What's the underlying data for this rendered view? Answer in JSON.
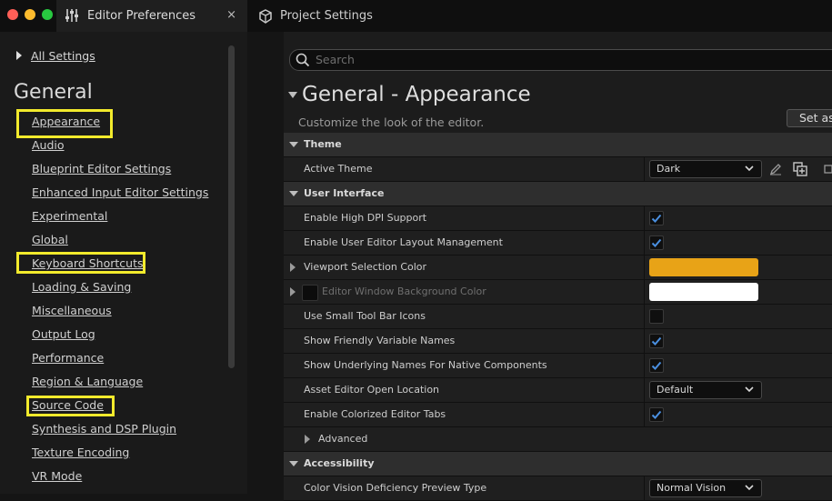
{
  "window": {
    "tabs": [
      {
        "label": "Editor Preferences",
        "icon": "sliders-icon",
        "active": true
      },
      {
        "label": "Project Settings",
        "icon": "cube-gear-icon",
        "active": false
      }
    ],
    "close_glyph": "×",
    "traffic_lights": [
      "#ff5f57",
      "#febc2e",
      "#28c840"
    ]
  },
  "sidebar": {
    "all_settings": "All Settings",
    "heading": "General",
    "categories": [
      {
        "label": "Appearance",
        "highlighted": true
      },
      {
        "label": "Audio",
        "highlighted": false
      },
      {
        "label": "Blueprint Editor Settings",
        "highlighted": false
      },
      {
        "label": "Enhanced Input Editor Settings",
        "highlighted": false
      },
      {
        "label": "Experimental",
        "highlighted": false
      },
      {
        "label": "Global",
        "highlighted": false
      },
      {
        "label": "Keyboard Shortcuts",
        "highlighted": true
      },
      {
        "label": "Loading & Saving",
        "highlighted": false
      },
      {
        "label": "Miscellaneous",
        "highlighted": false
      },
      {
        "label": "Output Log",
        "highlighted": false
      },
      {
        "label": "Performance",
        "highlighted": false
      },
      {
        "label": "Region & Language",
        "highlighted": false
      },
      {
        "label": "Source Code",
        "highlighted": true
      },
      {
        "label": "Synthesis and DSP Plugin",
        "highlighted": false
      },
      {
        "label": "Texture Encoding",
        "highlighted": false
      },
      {
        "label": "VR Mode",
        "highlighted": false
      }
    ],
    "highlight_color": "#f2ea2c"
  },
  "main": {
    "search_placeholder": "Search",
    "section_title": "General - Appearance",
    "section_description": "Customize the look of the editor.",
    "set_as_button": "Set as",
    "rows": [
      {
        "kind": "category",
        "label": "Theme"
      },
      {
        "kind": "prop",
        "label": "Active Theme",
        "control": "combo",
        "value": "Dark"
      },
      {
        "kind": "category",
        "label": "User Interface"
      },
      {
        "kind": "prop",
        "label": "Enable High DPI Support",
        "control": "check",
        "checked": true
      },
      {
        "kind": "prop",
        "label": "Enable User Editor Layout Management",
        "control": "check",
        "checked": true
      },
      {
        "kind": "prop",
        "label": "Viewport Selection Color",
        "control": "color",
        "color": "#e8a317",
        "expandable": true
      },
      {
        "kind": "prop",
        "label": "Editor Window Background Color",
        "control": "color",
        "color": "#ffffff",
        "expandable": true,
        "disabled": true
      },
      {
        "kind": "prop",
        "label": "Use Small Tool Bar Icons",
        "control": "check",
        "checked": false
      },
      {
        "kind": "prop",
        "label": "Show Friendly Variable Names",
        "control": "check",
        "checked": true
      },
      {
        "kind": "prop",
        "label": "Show Underlying Names For Native Components",
        "control": "check",
        "checked": true
      },
      {
        "kind": "prop",
        "label": "Asset Editor Open Location",
        "control": "combo",
        "value": "Default"
      },
      {
        "kind": "prop",
        "label": "Enable Colorized Editor Tabs",
        "control": "check",
        "checked": true
      },
      {
        "kind": "advanced",
        "label": "Advanced"
      },
      {
        "kind": "category",
        "label": "Accessibility"
      },
      {
        "kind": "prop",
        "label": "Color Vision Deficiency Preview Type",
        "control": "combo",
        "value": "Normal Vision"
      }
    ]
  },
  "colors": {
    "check": "#4a8fe0",
    "accent_bg": "#1c1c1c"
  }
}
